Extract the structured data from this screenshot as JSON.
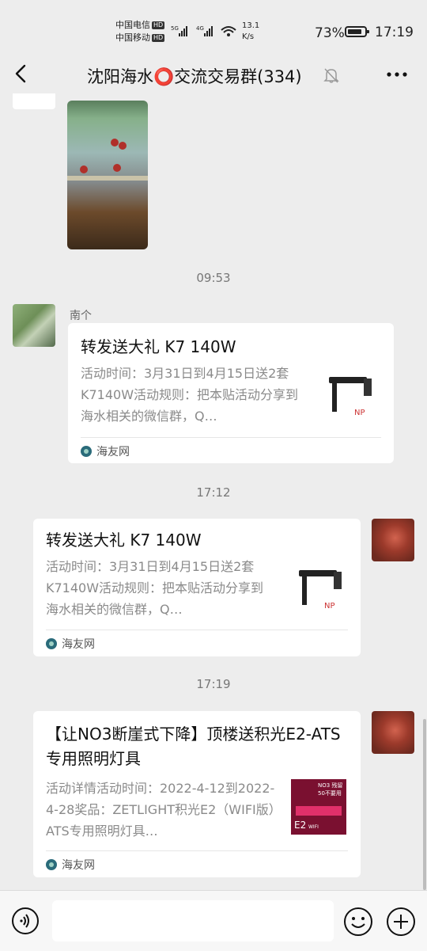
{
  "status_bar": {
    "carrier1": "中国电信",
    "carrier2": "中国移动",
    "hd": "HD",
    "net1": "5G",
    "net2": "4G",
    "speed_value": "13.1",
    "speed_unit": "K/s",
    "battery": "73%",
    "time": "17:19"
  },
  "header": {
    "title": "沈阳海水⭕交流交易群(334)"
  },
  "messages": {
    "time1": "09:53",
    "card1": {
      "sender": "南个",
      "title": "转发送大礼 K7 140W",
      "desc": "活动时间：3月31日到4月15日送2套K7140W活动规则：把本贴活动分享到海水相关的微信群，Q…",
      "source": "海友网"
    },
    "time2": "17:12",
    "card2": {
      "title": "转发送大礼 K7 140W",
      "desc": "活动时间：3月31日到4月15日送2套K7140W活动规则：把本贴活动分享到海水相关的微信群，Q…",
      "source": "海友网"
    },
    "time3": "17:19",
    "card3": {
      "title": "【让NO3断崖式下降】顶楼送积光E2-ATS专用照明灯具",
      "desc": "活动详情活动时间：2022-4-12到2022-4-28奖品：ZETLIGHT积光E2（WIFI版）ATS专用照明灯具…",
      "source": "海友网",
      "thumb_text1": "NO3 残留",
      "thumb_text2": "50不要用",
      "thumb_text3": "E2",
      "thumb_text4": "WIFI"
    }
  },
  "colors": {
    "background": "#ededed",
    "card": "#ffffff",
    "muted_text": "#8a8a8a"
  }
}
